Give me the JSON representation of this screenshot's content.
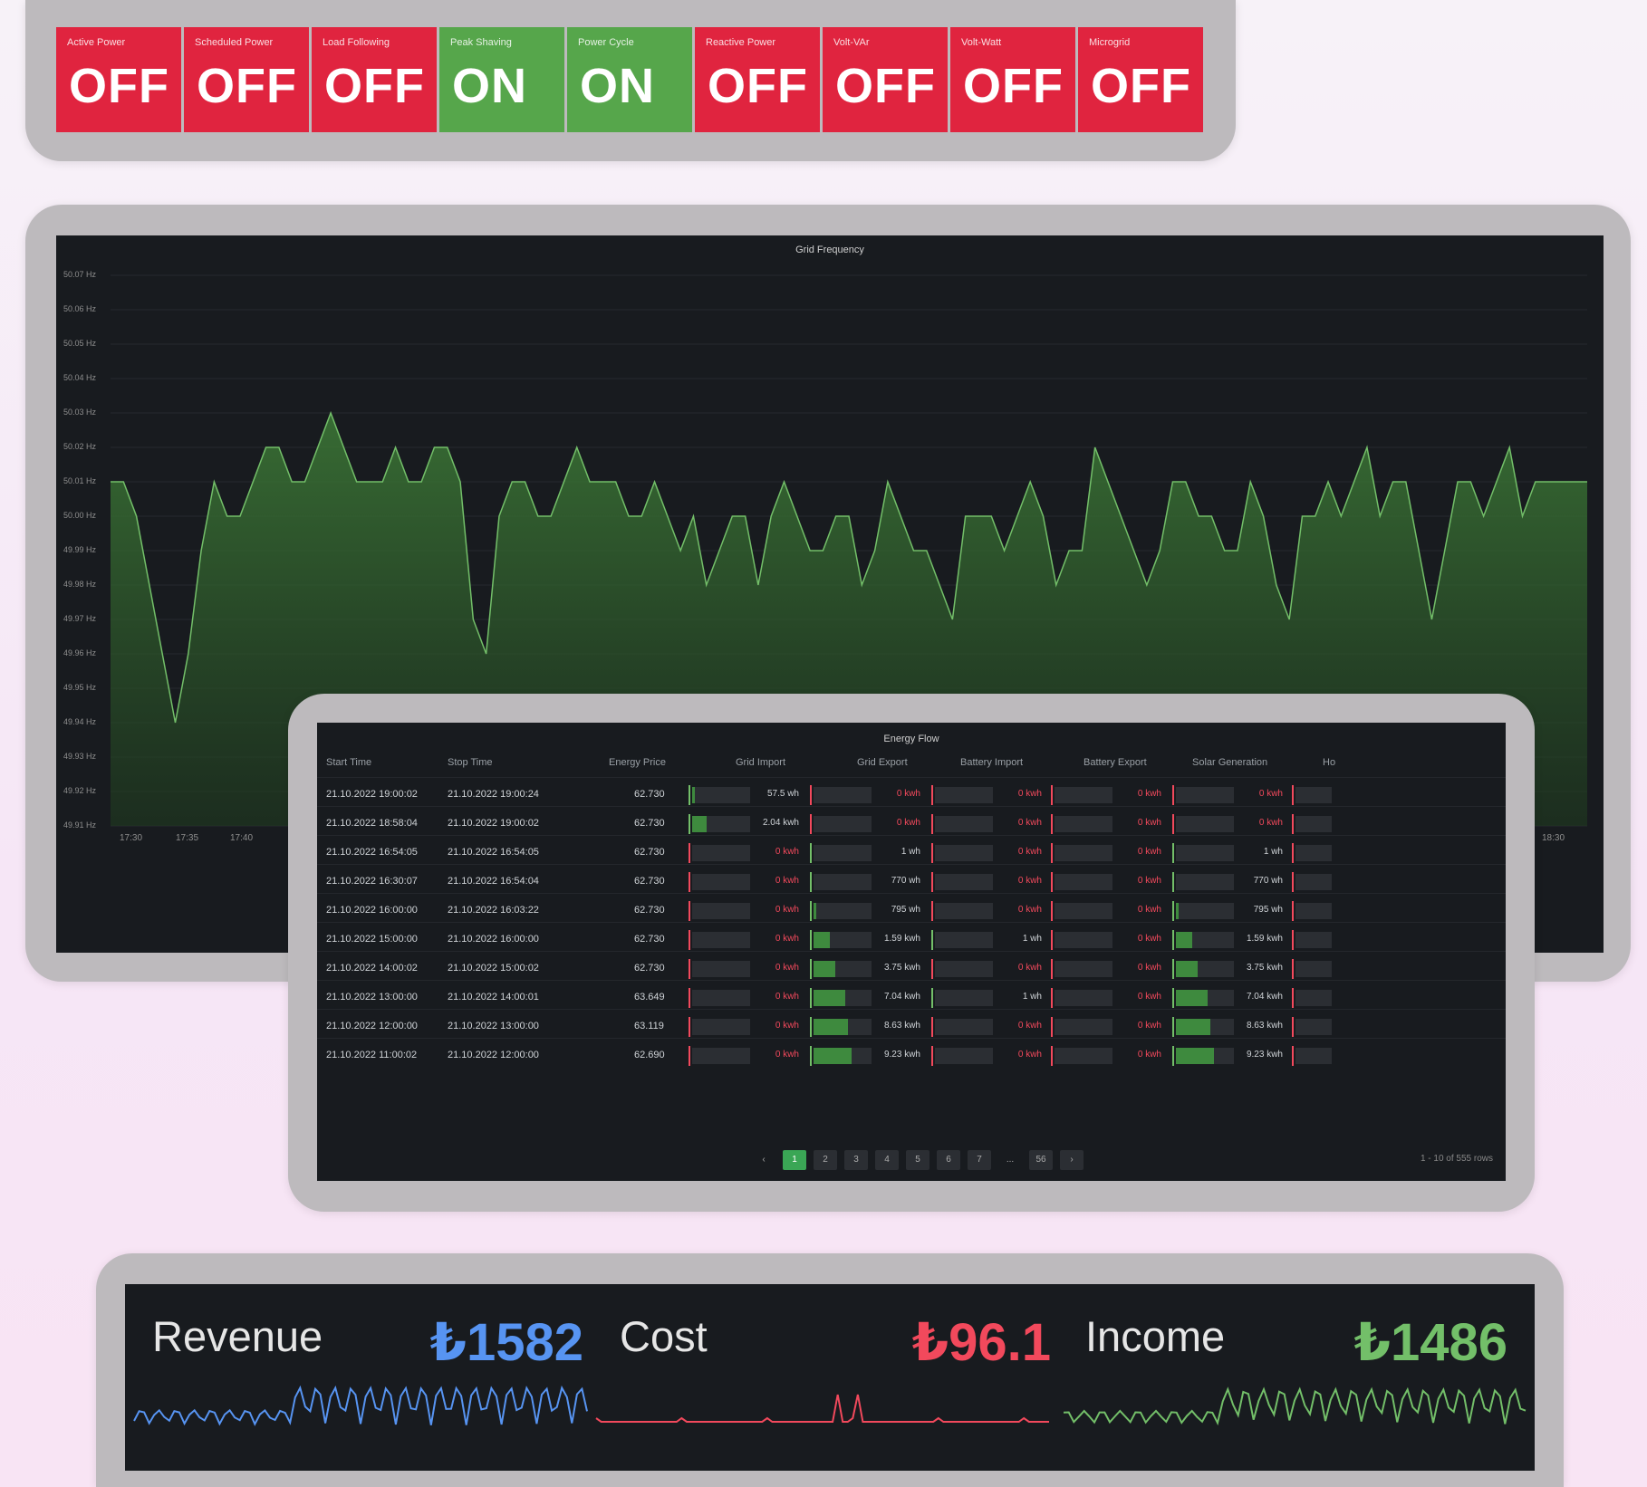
{
  "status_tiles": [
    {
      "label": "Active Power",
      "value": "OFF",
      "state": "off"
    },
    {
      "label": "Scheduled Power",
      "value": "OFF",
      "state": "off"
    },
    {
      "label": "Load Following",
      "value": "OFF",
      "state": "off"
    },
    {
      "label": "Peak Shaving",
      "value": "ON",
      "state": "on"
    },
    {
      "label": "Power Cycle",
      "value": "ON",
      "state": "on"
    },
    {
      "label": "Reactive Power",
      "value": "OFF",
      "state": "off"
    },
    {
      "label": "Volt-VAr",
      "value": "OFF",
      "state": "off"
    },
    {
      "label": "Volt-Watt",
      "value": "OFF",
      "state": "off"
    },
    {
      "label": "Microgrid",
      "value": "OFF",
      "state": "off"
    }
  ],
  "frequency_chart": {
    "title": "Grid Frequency",
    "y_ticks": [
      "50.07 Hz",
      "50.06 Hz",
      "50.05 Hz",
      "50.04 Hz",
      "50.03 Hz",
      "50.02 Hz",
      "50.01 Hz",
      "50.00 Hz",
      "49.99 Hz",
      "49.98 Hz",
      "49.97 Hz",
      "49.96 Hz",
      "49.95 Hz",
      "49.94 Hz",
      "49.93 Hz",
      "49.92 Hz",
      "49.91 Hz"
    ],
    "x_ticks": [
      "17:30",
      "17:35",
      "17:40",
      "18:30"
    ],
    "series_color": "#73bf69"
  },
  "chart_data": {
    "type": "area",
    "title": "Grid Frequency",
    "ylim": [
      49.91,
      50.07
    ],
    "unit": "Hz",
    "values": [
      50.01,
      50.01,
      50.0,
      49.98,
      49.96,
      49.94,
      49.96,
      49.99,
      50.01,
      50.0,
      50.0,
      50.01,
      50.02,
      50.02,
      50.01,
      50.01,
      50.02,
      50.03,
      50.02,
      50.01,
      50.01,
      50.01,
      50.02,
      50.01,
      50.01,
      50.02,
      50.02,
      50.01,
      49.97,
      49.96,
      50.0,
      50.01,
      50.01,
      50.0,
      50.0,
      50.01,
      50.02,
      50.01,
      50.01,
      50.01,
      50.0,
      50.0,
      50.01,
      50.0,
      49.99,
      50.0,
      49.98,
      49.99,
      50.0,
      50.0,
      49.98,
      50.0,
      50.01,
      50.0,
      49.99,
      49.99,
      50.0,
      50.0,
      49.98,
      49.99,
      50.01,
      50.0,
      49.99,
      49.99,
      49.98,
      49.97,
      50.0,
      50.0,
      50.0,
      49.99,
      50.0,
      50.01,
      50.0,
      49.98,
      49.99,
      49.99,
      50.02,
      50.01,
      50.0,
      49.99,
      49.98,
      49.99,
      50.01,
      50.01,
      50.0,
      50.0,
      49.99,
      49.99,
      50.01,
      50.0,
      49.98,
      49.97,
      50.0,
      50.0,
      50.01,
      50.0,
      50.01,
      50.02,
      50.0,
      50.01,
      50.01,
      49.99,
      49.97,
      49.99,
      50.01,
      50.01,
      50.0,
      50.01,
      50.02,
      50.0,
      50.01,
      50.01,
      50.01,
      50.01,
      50.01
    ],
    "x_ticks": [
      "17:30",
      "17:35",
      "17:40",
      "18:30"
    ]
  },
  "energy_table": {
    "title": "Energy Flow",
    "columns": [
      "Start Time",
      "Stop Time",
      "Energy Price",
      "Grid Import",
      "Grid Export",
      "Battery Import",
      "Battery Export",
      "Solar Generation",
      "Ho"
    ],
    "rows": [
      {
        "start": "21.10.2022 19:00:02",
        "stop": "21.10.2022 19:00:24",
        "price": "62.730",
        "grid_import": "57.5 wh",
        "grid_export": "0 kwh",
        "battery_import": "0 kwh",
        "battery_export": "0 kwh",
        "solar": "0 kwh",
        "gi": 0.05,
        "solar_fill": 0.0
      },
      {
        "start": "21.10.2022 18:58:04",
        "stop": "21.10.2022 19:00:02",
        "price": "62.730",
        "grid_import": "2.04 kwh",
        "grid_export": "0 kwh",
        "battery_import": "0 kwh",
        "battery_export": "0 kwh",
        "solar": "0 kwh",
        "gi": 0.25,
        "solar_fill": 0.0
      },
      {
        "start": "21.10.2022 16:54:05",
        "stop": "21.10.2022 16:54:05",
        "price": "62.730",
        "grid_import": "0 kwh",
        "grid_export": "1 wh",
        "battery_import": "0 kwh",
        "battery_export": "0 kwh",
        "solar": "1 wh",
        "gi": 0.0,
        "solar_fill": 0.0
      },
      {
        "start": "21.10.2022 16:30:07",
        "stop": "21.10.2022 16:54:04",
        "price": "62.730",
        "grid_import": "0 kwh",
        "grid_export": "770 wh",
        "battery_import": "0 kwh",
        "battery_export": "0 kwh",
        "solar": "770 wh",
        "gi": 0.0,
        "solar_fill": 0.0
      },
      {
        "start": "21.10.2022 16:00:00",
        "stop": "21.10.2022 16:03:22",
        "price": "62.730",
        "grid_import": "0 kwh",
        "grid_export": "795 wh",
        "battery_import": "0 kwh",
        "battery_export": "0 kwh",
        "solar": "795 wh",
        "gi": 0.0,
        "solar_fill": 0.04
      },
      {
        "start": "21.10.2022 15:00:00",
        "stop": "21.10.2022 16:00:00",
        "price": "62.730",
        "grid_import": "0 kwh",
        "grid_export": "1.59 kwh",
        "battery_import": "1 wh",
        "battery_export": "0 kwh",
        "solar": "1.59 kwh",
        "gi": 0.0,
        "solar_fill": 0.28
      },
      {
        "start": "21.10.2022 14:00:02",
        "stop": "21.10.2022 15:00:02",
        "price": "62.730",
        "grid_import": "0 kwh",
        "grid_export": "3.75 kwh",
        "battery_import": "0 kwh",
        "battery_export": "0 kwh",
        "solar": "3.75 kwh",
        "gi": 0.0,
        "solar_fill": 0.38
      },
      {
        "start": "21.10.2022 13:00:00",
        "stop": "21.10.2022 14:00:01",
        "price": "63.649",
        "grid_import": "0 kwh",
        "grid_export": "7.04 kwh",
        "battery_import": "1 wh",
        "battery_export": "0 kwh",
        "solar": "7.04 kwh",
        "gi": 0.0,
        "solar_fill": 0.55
      },
      {
        "start": "21.10.2022 12:00:00",
        "stop": "21.10.2022 13:00:00",
        "price": "63.119",
        "grid_import": "0 kwh",
        "grid_export": "8.63 kwh",
        "battery_import": "0 kwh",
        "battery_export": "0 kwh",
        "solar": "8.63 kwh",
        "gi": 0.0,
        "solar_fill": 0.6
      },
      {
        "start": "21.10.2022 11:00:02",
        "stop": "21.10.2022 12:00:00",
        "price": "62.690",
        "grid_import": "0 kwh",
        "grid_export": "9.23 kwh",
        "battery_import": "0 kwh",
        "battery_export": "0 kwh",
        "solar": "9.23 kwh",
        "gi": 0.0,
        "solar_fill": 0.65
      }
    ],
    "pages": [
      "1",
      "2",
      "3",
      "4",
      "5",
      "6",
      "7",
      "...",
      "56"
    ],
    "active_page": "1",
    "prev_icon": "‹",
    "next_icon": "›",
    "row_count": "1 - 10 of 555 rows"
  },
  "stats": {
    "revenue": {
      "label": "Revenue",
      "value": "₺1582",
      "color": "#5794f2"
    },
    "cost": {
      "label": "Cost",
      "value": "₺96.1",
      "color": "#f2495c"
    },
    "income": {
      "label": "Income",
      "value": "₺1486",
      "color": "#73bf69"
    }
  },
  "colors": {
    "red": "#e0243f",
    "green": "#56a64b",
    "panel": "#181b1f"
  }
}
